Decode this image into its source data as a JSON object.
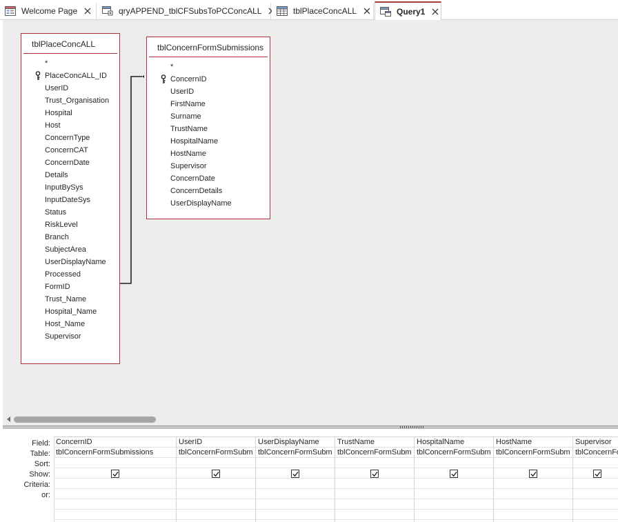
{
  "tabs": [
    {
      "label": "Welcome Page",
      "icon": "form-icon",
      "close": "close-icon"
    },
    {
      "label": "qryAPPEND_tblCFSubsToPCConcALL",
      "icon": "append-query-icon",
      "close": "close-icon"
    },
    {
      "label": "tblPlaceConcALL",
      "icon": "table-icon",
      "close": "close-icon"
    },
    {
      "label": "Query1",
      "icon": "query-icon",
      "close": "close-icon",
      "active": true
    }
  ],
  "tables": [
    {
      "title": "tblPlaceConcALL",
      "fields": [
        "*",
        "PlaceConcALL_ID",
        "UserID",
        "Trust_Organisation",
        "Hospital",
        "Host",
        "ConcernType",
        "ConcernCAT",
        "ConcernDate",
        "Details",
        "InputBySys",
        "InputDateSys",
        "Status",
        "RiskLevel",
        "Branch",
        "SubjectArea",
        "UserDisplayName",
        "Processed",
        "FormID",
        "Trust_Name",
        "Hospital_Name",
        "Host_Name",
        "Supervisor"
      ],
      "key_field": "PlaceConcALL_ID"
    },
    {
      "title": "tblConcernFormSubmissions",
      "fields": [
        "*",
        "ConcernID",
        "UserID",
        "FirstName",
        "Surname",
        "TrustName",
        "HospitalName",
        "HostName",
        "Supervisor",
        "ConcernDate",
        "ConcernDetails",
        "UserDisplayName"
      ],
      "key_field": "ConcernID"
    }
  ],
  "join": {
    "from_table": "tblPlaceConcALL",
    "from_field": "FormID",
    "to_table": "tblConcernFormSubmissions",
    "to_field": "ConcernID"
  },
  "grid": {
    "row_labels": {
      "field": "Field:",
      "table": "Table:",
      "sort": "Sort:",
      "show": "Show:",
      "criteria": "Criteria:",
      "or": "or:"
    },
    "columns": [
      {
        "field": "ConcernID",
        "table": "tblConcernFormSubmissions",
        "show": true
      },
      {
        "field": "UserID",
        "table": "tblConcernFormSubm",
        "show": true
      },
      {
        "field": "UserDisplayName",
        "table": "tblConcernFormSubm",
        "show": true
      },
      {
        "field": "TrustName",
        "table": "tblConcernFormSubm",
        "show": true
      },
      {
        "field": "HospitalName",
        "table": "tblConcernFormSubm",
        "show": true
      },
      {
        "field": "HostName",
        "table": "tblConcernFormSubm",
        "show": true
      },
      {
        "field": "Supervisor",
        "table": "tblConcernFo",
        "show": true
      }
    ]
  },
  "colors": {
    "accent": "#a4373a",
    "table_border": "#b2303a",
    "surface": "#ececec",
    "scroll_thumb": "#a6a6a6"
  }
}
